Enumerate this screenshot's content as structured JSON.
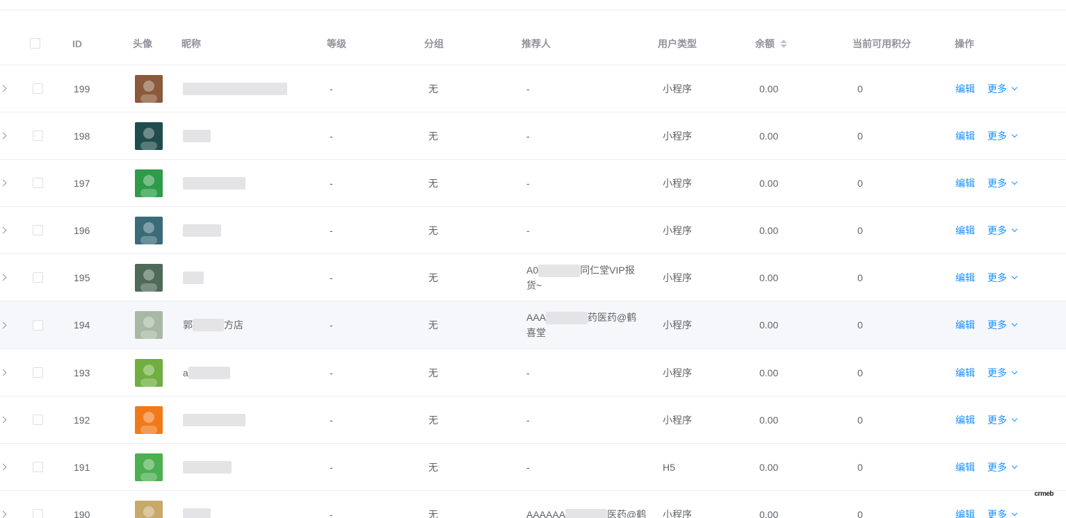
{
  "columns": {
    "id": "ID",
    "avatar": "头像",
    "nickname": "昵称",
    "level": "等级",
    "group": "分组",
    "referrer": "推荐人",
    "user_type": "用户类型",
    "balance": "余额",
    "points": "当前可用积分",
    "actions": "操作"
  },
  "actions": {
    "edit": "编辑",
    "more": "更多"
  },
  "rows": [
    {
      "id": "199",
      "nickname": "",
      "level": "-",
      "group": "无",
      "referrer": "-",
      "user_type": "小程序",
      "balance": "0.00",
      "points": "0",
      "avatar_color": "#8a5a3a"
    },
    {
      "id": "198",
      "nickname": "",
      "level": "-",
      "group": "无",
      "referrer": "-",
      "user_type": "小程序",
      "balance": "0.00",
      "points": "0",
      "avatar_color": "#1f4d4d"
    },
    {
      "id": "197",
      "nickname": "",
      "level": "-",
      "group": "无",
      "referrer": "-",
      "user_type": "小程序",
      "balance": "0.00",
      "points": "0",
      "avatar_color": "#2e9b4a"
    },
    {
      "id": "196",
      "nickname": "",
      "level": "-",
      "group": "无",
      "referrer": "-",
      "user_type": "小程序",
      "balance": "0.00",
      "points": "0",
      "avatar_color": "#3b6b78"
    },
    {
      "id": "195",
      "nickname": "",
      "level": "-",
      "group": "无",
      "referrer": "A0",
      "referrer2": "同仁堂VIP报",
      "referrer3": "货~",
      "user_type": "小程序",
      "balance": "0.00",
      "points": "0",
      "avatar_color": "#4f6a58"
    },
    {
      "id": "194",
      "nickname": "郭",
      "nickname2": "方店",
      "level": "-",
      "group": "无",
      "referrer": "AAA",
      "referrer2": "药医药@鹤",
      "referrer3": "喜堂",
      "user_type": "小程序",
      "balance": "0.00",
      "points": "0",
      "avatar_color": "#a7b9a4"
    },
    {
      "id": "193",
      "nickname": "a",
      "level": "-",
      "group": "无",
      "referrer": "-",
      "user_type": "小程序",
      "balance": "0.00",
      "points": "0",
      "avatar_color": "#6fae3f"
    },
    {
      "id": "192",
      "nickname": "",
      "level": "-",
      "group": "无",
      "referrer": "-",
      "user_type": "小程序",
      "balance": "0.00",
      "points": "0",
      "avatar_color": "#f07a1a"
    },
    {
      "id": "191",
      "nickname": "",
      "level": "-",
      "group": "无",
      "referrer": "-",
      "user_type": "H5",
      "balance": "0.00",
      "points": "0",
      "avatar_color": "#4caf50"
    },
    {
      "id": "190",
      "nickname": "",
      "level": "-",
      "group": "无",
      "referrer": "AAAAAA",
      "referrer2": "医药@鹤",
      "user_type": "小程序",
      "balance": "0.00",
      "points": "0",
      "avatar_color": "#c9a96a"
    }
  ],
  "watermark": "crmeb"
}
